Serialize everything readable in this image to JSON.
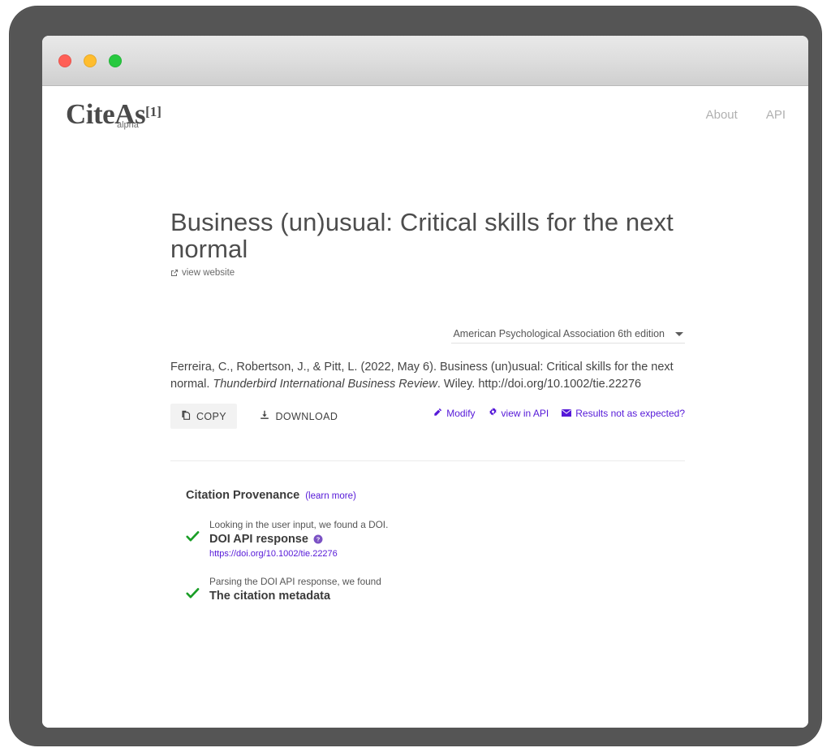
{
  "window": {
    "traffic_lights": [
      {
        "name": "close",
        "color": "#ff5f56"
      },
      {
        "name": "minimize",
        "color": "#ffbd2e"
      },
      {
        "name": "zoom",
        "color": "#27c93f"
      }
    ]
  },
  "header": {
    "logo_word": "CiteAs",
    "logo_superscript": "[1]",
    "logo_alpha": "alpha",
    "nav": [
      {
        "label": "About"
      },
      {
        "label": "API"
      }
    ]
  },
  "main": {
    "title": "Business (un)usual: Critical skills for the next normal",
    "view_website_label": "view website",
    "style_selector": {
      "selected": "American Psychological Association 6th edition"
    },
    "citation": {
      "part1": "Ferreira, C., Robertson, J., & Pitt, L. (2022, May 6). Business (un)usual: Critical skills for the next normal. ",
      "venue": "Thunderbird International Business Review",
      "part2": ". Wiley. http://doi.org/10.1002/tie.22276"
    },
    "buttons": {
      "copy": "COPY",
      "download": "DOWNLOAD"
    },
    "meta_links": [
      {
        "label": "Modify",
        "icon": "pencil-icon"
      },
      {
        "label": "view in API",
        "icon": "gear-icon"
      },
      {
        "label": "Results not as expected?",
        "icon": "envelope-icon"
      }
    ],
    "link_color": "#5518d8"
  },
  "provenance": {
    "title": "Citation Provenance",
    "learn_more": "(learn more)",
    "steps": [
      {
        "description": "Looking in the user input, we found a DOI.",
        "name": "DOI API response",
        "has_help": true,
        "url": "https://doi.org/10.1002/tie.22276"
      },
      {
        "description": "Parsing the DOI API response, we found",
        "name": "The citation metadata",
        "has_help": false,
        "url": ""
      }
    ],
    "check_color": "#1a9e26"
  }
}
